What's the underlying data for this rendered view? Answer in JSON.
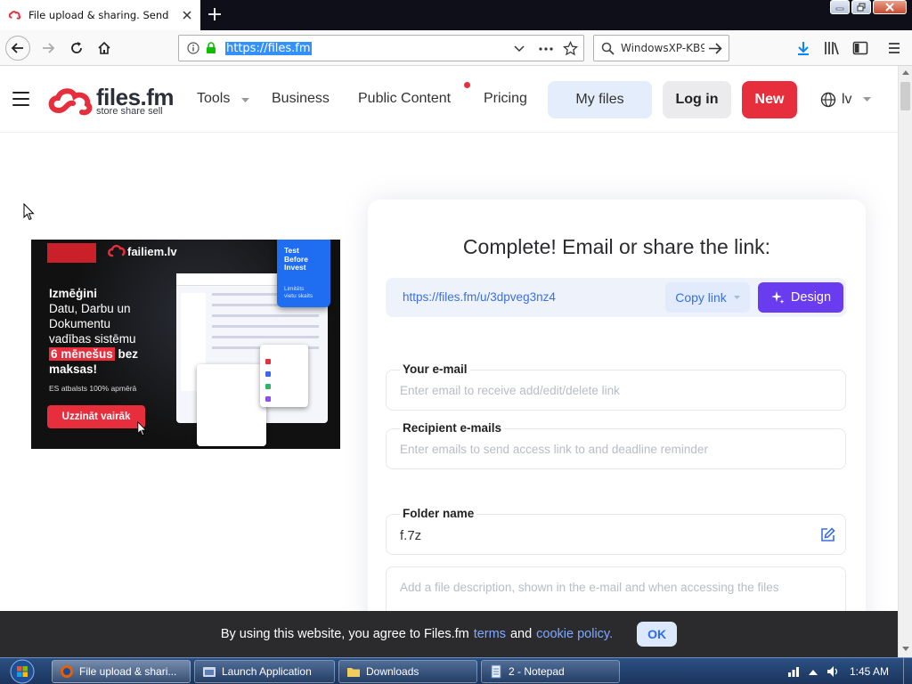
{
  "browser": {
    "tab_title": "File upload & sharing. Send large files",
    "url": "https://files.fm",
    "search_text": "WindowsXP-KB9"
  },
  "site": {
    "logo_word": "files.fm",
    "logo_tagline": "store share sell",
    "menu": {
      "tools": "Tools",
      "business": "Business",
      "public_content": "Public Content",
      "pricing": "Pricing"
    },
    "my_files": "My files",
    "login": "Log in",
    "new": "New",
    "language": "lv"
  },
  "ad": {
    "brand": "failiem.lv",
    "badge_line1": "Test",
    "badge_line2": "Before",
    "badge_line3": "Invest",
    "badge_sub1": "Limitēts",
    "badge_sub2": "vietu skaits",
    "headline_1": "Izmēģini",
    "headline_2": "Datu, Darbu un",
    "headline_3": "Dokumentu",
    "headline_4": "vadības sistēmu",
    "headline_highlight": "6 mēnešus",
    "headline_bez": " bez",
    "headline_6": "maksas!",
    "support": "ES atbalsts 100% apmērā",
    "cta": "Uzzināt vairāk"
  },
  "share": {
    "title": "Complete! Email or share the link:",
    "link": "https://files.fm/u/3dpveg3nz4",
    "copy_link": "Copy link",
    "design": "Design",
    "your_email_label": "Your e-mail",
    "your_email_placeholder": "Enter email to receive add/edit/delete link",
    "recipient_label": "Recipient e-mails",
    "recipient_placeholder": "Enter emails to send access link to and deadline reminder",
    "folder_label": "Folder name",
    "folder_value": "f.7z",
    "description_placeholder": "Add a file description, shown in the e-mail and when accessing the files"
  },
  "cookie": {
    "text_prefix": "By using this website, you agree to Files.fm",
    "terms": "terms",
    "and": "and",
    "cookie_policy": "cookie policy.",
    "ok": "OK"
  },
  "taskbar": {
    "items": [
      "File upload & shari...",
      "Launch Application",
      "Downloads",
      "2 - Notepad"
    ],
    "time": "1:45 AM"
  },
  "colors": {
    "brand_red": "#e62e3d",
    "design_purple": "#6a3cf0",
    "link_blue": "#2f6cf0"
  }
}
